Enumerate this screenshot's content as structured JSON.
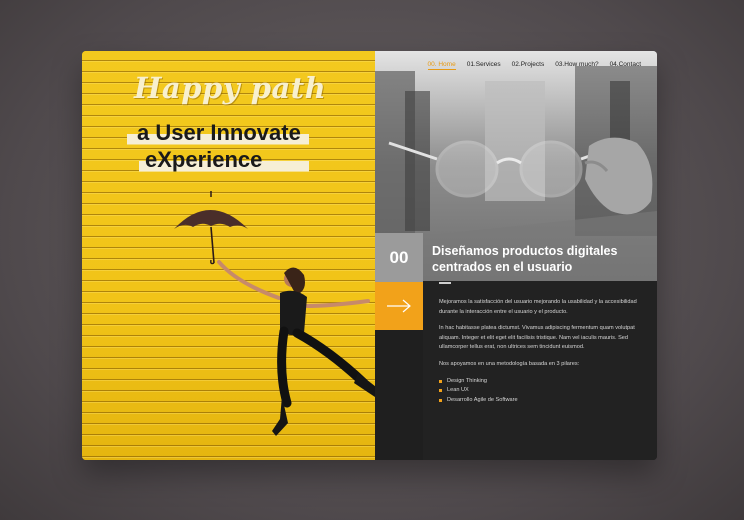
{
  "nav": {
    "items": [
      "00. Home",
      "01.Services",
      "02.Projects",
      "03.How much?",
      "04.Contact"
    ],
    "active_index": 0
  },
  "hero": {
    "tagline": "Happy path",
    "headline_line1": "a User Innovate",
    "headline_line2": "eXperience"
  },
  "section": {
    "number": "00",
    "title": "Diseñamos productos digitales centrados en el usuario",
    "paragraph1": "Mejoramos la satisfacción del usuario mejorando la usabilidad y la accesibilidad durante la interacción entre el usuario y el producto.",
    "paragraph2": "In hac habitasse platea dictumst. Vivamus adipiscing fermentum quam volutpat aliquam. Integer et elit eget elit facilisis tristique. Nam vel iaculis mauris. Sed ullamcorper tellus erat, non ultrices sem tincidunt euismod.",
    "paragraph3": "Nos apoyamos en una metodología basada en 3 pilares:",
    "pillars": [
      "Design Thinking",
      "Lean UX",
      "Desarrollo Agile de Software"
    ]
  },
  "colors": {
    "accent": "#f2a21a",
    "hero_yellow": "#f0c419",
    "panel_dark": "#222222"
  }
}
